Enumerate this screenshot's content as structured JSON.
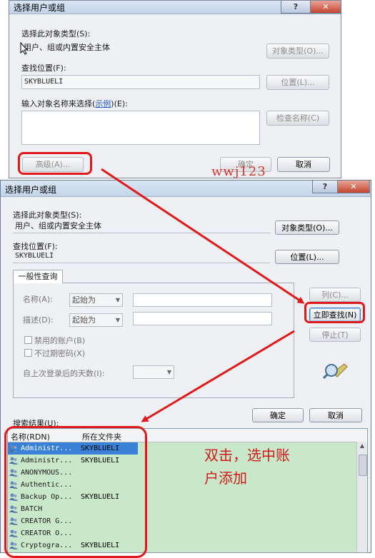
{
  "dialog_back": {
    "title": "选择用户或组",
    "help_glyph": "?",
    "close_glyph": "✕",
    "object_type_label": "选择此对象类型(S):",
    "object_type_value": "用户、组或内置安全主体",
    "object_type_button": "对象类型(O)...",
    "location_label": "查找位置(F):",
    "location_value": "SKYBLUELI",
    "location_button": "位置(L)...",
    "enter_label_prefix": "输入对象名称来选择(",
    "enter_label_link": "示例",
    "enter_label_suffix": ")(E):",
    "check_names_button": "检查名称(C)",
    "advanced_button": "高级(A)...",
    "ok_button": "确定",
    "cancel_button": "取消"
  },
  "watermark": "wwj123",
  "dialog_front": {
    "title": "选择用户或组",
    "help_glyph": "?",
    "close_glyph": "✕",
    "object_type_label": "选择此对象类型(S):",
    "object_type_value": "用户、组或内置安全主体",
    "object_type_button": "对象类型(O)...",
    "location_label": "查找位置(F):",
    "location_value": "SKYBLUELI",
    "location_button": "位置(L)...",
    "tab_label": "一般性查询",
    "name_label": "名称(A):",
    "name_mode": "起始为",
    "desc_label": "描述(D):",
    "desc_mode": "起始为",
    "disabled_accounts": "禁用的账户(B)",
    "non_expiring_pw": "不过期密码(X)",
    "days_since_login": "自上次登录后的天数(I):",
    "columns_button": "列(C)...",
    "find_now_button": "立即查找(N)",
    "stop_button": "停止(T)",
    "ok_button": "确定",
    "cancel_button": "取消",
    "results_label": "搜索结果(U):",
    "col_name": "名称(RDN)",
    "col_folder": "所在文件夹",
    "rows": [
      {
        "name": "Administr...",
        "folder": "SKYBLUELI"
      },
      {
        "name": "Administr...",
        "folder": "SKYBLUELI"
      },
      {
        "name": "ANONYMOUS...",
        "folder": ""
      },
      {
        "name": "Authentic...",
        "folder": ""
      },
      {
        "name": "Backup Op...",
        "folder": "SKYBLUELI"
      },
      {
        "name": "BATCH",
        "folder": ""
      },
      {
        "name": "CREATOR G...",
        "folder": ""
      },
      {
        "name": "CREATOR O...",
        "folder": ""
      },
      {
        "name": "Cryptogra...",
        "folder": "SKYBLUELI"
      }
    ]
  },
  "annotation_line1": "双击，选中账",
  "annotation_line2": "户添加",
  "colors": {
    "annotation_red": "#e01a1a",
    "selection_blue": "#3a80d6",
    "results_background": "#c9e7c9"
  }
}
